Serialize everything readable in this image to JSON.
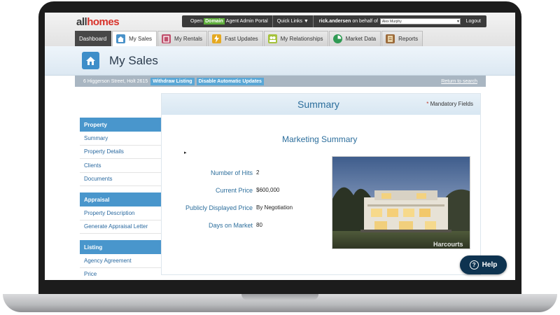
{
  "brand": {
    "logo_all": "all",
    "logo_homes": "homes"
  },
  "portal": {
    "open_label": "Open",
    "domain_label": "Domain",
    "portal_label": "Agent Admin Portal",
    "quick_links": "Quick Links ▼",
    "username": "rick.andersen",
    "on_behalf": "on behalf of",
    "behalf_selected": "Alex Murphy",
    "logout": "Logout"
  },
  "tabs": [
    {
      "label": "Dashboard",
      "icon": "none"
    },
    {
      "label": "My Sales",
      "icon": "home-icon"
    },
    {
      "label": "My Rentals",
      "icon": "rentals-icon"
    },
    {
      "label": "Fast Updates",
      "icon": "lightning-icon"
    },
    {
      "label": "My Relationships",
      "icon": "relationships-icon"
    },
    {
      "label": "Market Data",
      "icon": "chart-icon"
    },
    {
      "label": "Reports",
      "icon": "reports-icon"
    }
  ],
  "page": {
    "title": "My Sales"
  },
  "address_bar": {
    "address": "6 Higgerson Street, Holt 2615",
    "withdraw": "Withdraw Listing",
    "disable_updates": "Disable Automatic Updates",
    "return_link": "Return to search"
  },
  "sidebar": {
    "sections": [
      {
        "heading": "Property",
        "items": [
          "Summary",
          "Property Details",
          "Clients",
          "Documents"
        ]
      },
      {
        "heading": "Appraisal",
        "items": [
          "Property Description",
          "Generate Appraisal Letter"
        ]
      },
      {
        "heading": "Listing",
        "items": [
          "Agency Agreement",
          "Price"
        ]
      }
    ]
  },
  "main": {
    "title": "Summary",
    "mandatory_star": "*",
    "mandatory_label": "Mandatory Fields",
    "marketing_title": "Marketing Summary",
    "fields": [
      {
        "label": "Number of Hits",
        "value": "2"
      },
      {
        "label": "Current Price",
        "value": "$600,000"
      },
      {
        "label": "Publicly Displayed Price",
        "value": "By Negotiation"
      },
      {
        "label": "Days on Market",
        "value": "80"
      }
    ],
    "photo_watermark": "Harcourts"
  },
  "help": {
    "label": "Help",
    "icon_glyph": "?"
  },
  "colors": {
    "accent": "#4996cc",
    "brand_red": "#d8322a",
    "domain_green": "#5fae3c",
    "help_bg": "#0e3350"
  }
}
